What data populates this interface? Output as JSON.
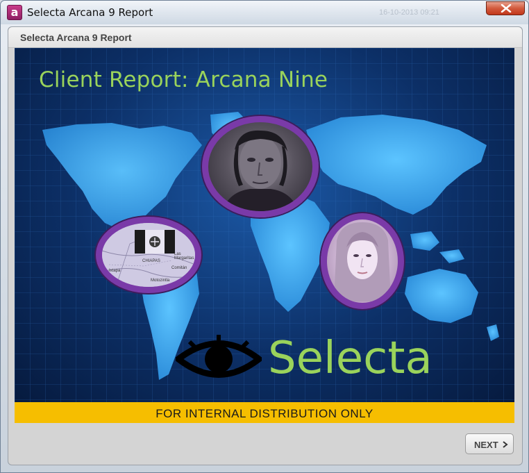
{
  "window": {
    "title": "Selecta Arcana 9 Report",
    "faded_stamp": "16-10-2013 09:21",
    "app_icon_glyph": "a",
    "close_icon": "close-icon",
    "accent_close": "#c2371b"
  },
  "panel": {
    "title": "Selecta Arcana 9 Report"
  },
  "slide": {
    "title": "Client Report: Arcana Nine",
    "brand": "Selecta",
    "brand_color": "#9ad35b",
    "ring_color": "#7a3aa8",
    "map_labels": [
      "CHIAPAS",
      "Las Margaritas",
      "Ixtapa",
      "Comitán",
      "Motozintla"
    ]
  },
  "banner": {
    "text": "FOR INTERNAL DISTRIBUTION ONLY",
    "color": "#f6be00"
  },
  "nav": {
    "next_label": "NEXT",
    "next_icon": "chevron-right-icon"
  }
}
